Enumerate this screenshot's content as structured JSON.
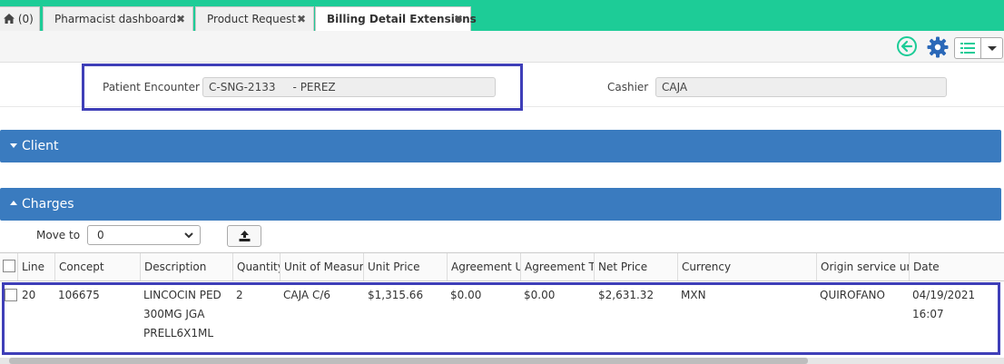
{
  "tabs": [
    {
      "label": "(0)",
      "icon": "home-icon"
    },
    {
      "label": "Pharmacist dashboard",
      "closable": true
    },
    {
      "label": "Product Request",
      "closable": true
    },
    {
      "label": "Billing Detail Extensions",
      "closable": true,
      "active": true
    }
  ],
  "toolbar": {
    "icons": [
      "back-circle-icon",
      "gear-icon",
      "list-icon",
      "caret-down-icon"
    ]
  },
  "form": {
    "encounter_label": "Patient Encounter",
    "encounter_value": "C-SNG-2133     - PEREZ",
    "cashier_label": "Cashier",
    "cashier_value": "CAJA"
  },
  "sections": {
    "client": "Client",
    "charges": "Charges"
  },
  "moveto": {
    "label": "Move to",
    "value": "0"
  },
  "table": {
    "headers": [
      "Line",
      "Concept",
      "Description",
      "Quantity",
      "Unit of Measure",
      "Unit Price",
      "Agreement Unit",
      "Agreement Total",
      "Net Price",
      "Currency",
      "Origin service unit",
      "Date"
    ],
    "rows": [
      {
        "line": "20",
        "concept": "106675",
        "description": "LINCOCIN PED 300MG JGA PRELL6X1ML",
        "quantity": "2",
        "uom": "CAJA C/6",
        "unit_price": "$1,315.66",
        "agreement_unit": "$0.00",
        "agreement_total": "$0.00",
        "net_price": "$2,631.32",
        "currency": "MXN",
        "origin": "QUIROFANO",
        "date": "04/19/2021 16:07"
      }
    ]
  },
  "colors": {
    "tabbar": "#1dcc97",
    "section": "#3a7bbf",
    "highlight": "#3f3fb8"
  }
}
